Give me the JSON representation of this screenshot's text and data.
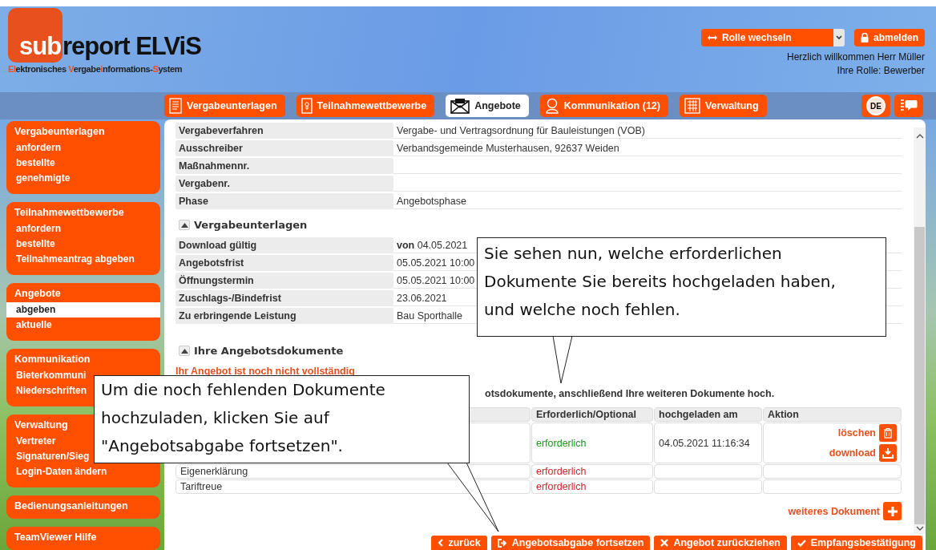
{
  "logo": {
    "mark": "sub",
    "name": "report ELViS",
    "tagline": [
      {
        "text": "El",
        "accent": true
      },
      {
        "text": "ektronisches ",
        "accent": false
      },
      {
        "text": "V",
        "accent": true
      },
      {
        "text": "ergabe",
        "accent": false
      },
      {
        "text": "i",
        "accent": true
      },
      {
        "text": "nformations-",
        "accent": false
      },
      {
        "text": "S",
        "accent": true
      },
      {
        "text": "ystem",
        "accent": false
      }
    ]
  },
  "account": {
    "role_switch": "Rolle wechseln",
    "logout": "abmelden",
    "welcome": "Herzlich willkommen Herr Müller",
    "role": "Ihre Rolle: Bewerber"
  },
  "tabs": [
    {
      "label": "Vergabeunterlagen",
      "kind": "document",
      "selected": false
    },
    {
      "label": "Teilnahmewettbewerbe",
      "kind": "keyhole",
      "selected": false
    },
    {
      "label": "Angebote",
      "kind": "envelope",
      "selected": true
    },
    {
      "label": "Kommunikation (12)",
      "kind": "person",
      "selected": false
    },
    {
      "label": "Verwaltung",
      "kind": "building",
      "selected": false
    }
  ],
  "language": "DE",
  "sidebar": [
    {
      "title": "Vergabeunterlagen",
      "items": [
        {
          "label": "anfordern",
          "selected": false
        },
        {
          "label": "bestellte",
          "selected": false
        },
        {
          "label": "genehmigte",
          "selected": false
        }
      ]
    },
    {
      "title": "Teilnahmewettbewerbe",
      "items": [
        {
          "label": "anfordern",
          "selected": false
        },
        {
          "label": "bestellte",
          "selected": false
        },
        {
          "label": "Teilnahmeantrag abgeben",
          "selected": false
        }
      ]
    },
    {
      "title": "Angebote",
      "items": [
        {
          "label": "abgeben",
          "selected": true
        },
        {
          "label": "aktuelle",
          "selected": false
        }
      ]
    },
    {
      "title": "Kommunikation",
      "items": [
        {
          "label": "Bieterkommuni",
          "selected": false
        },
        {
          "label": "Niederschriften",
          "selected": false
        }
      ]
    },
    {
      "title": "Verwaltung",
      "items": [
        {
          "label": "Vertreter",
          "selected": false
        },
        {
          "label": "Signaturen/Sieg",
          "selected": false
        },
        {
          "label": "Login-Daten ändern",
          "selected": false
        }
      ]
    },
    {
      "title": "Bedienungsanleitungen"
    },
    {
      "title": "TeamViewer Hilfe"
    }
  ],
  "details": [
    {
      "label": "Vergabeverfahren",
      "value": "Vergabe- und Vertragsordnung für Bauleistungen (VOB)"
    },
    {
      "label": "Ausschreiber",
      "value": "Verbandsgemeinde Musterhausen, 92637 Weiden"
    },
    {
      "label": "Maßnahmennr."
    },
    {
      "label": "Vergabenr."
    },
    {
      "label": "Phase",
      "value": "Angebotsphase"
    }
  ],
  "tender_section": {
    "title": "Vergabeunterlagen",
    "expanded": true,
    "rows": [
      {
        "label": "Download gültig",
        "value": "**von**  04.05.2021"
      },
      {
        "label": "Angebotsfrist",
        "value": "05.05.2021 10:00"
      },
      {
        "label": "Öffnungstermin",
        "value": "05.05.2021 10:00"
      },
      {
        "label": "Zuschlags-/Bindefrist",
        "value": "23.06.2021"
      },
      {
        "label": "Zu erbringende Leistung",
        "value": "Bau Sporthalle"
      }
    ]
  },
  "documents_section": {
    "title": "Ihre Angebotsdokumente",
    "expanded": true,
    "warning": "Ihr Angebot ist noch nicht vollständig",
    "instruction": "otsdokumente, anschließend Ihre weiteren Dokumente hoch.",
    "columns": [
      "Erforderlich/Optional",
      "hochgeladen am",
      "Aktion"
    ],
    "rows": [
      {
        "requirement": "erforderlich",
        "uploaded": true,
        "uploaded_at": "04.05.2021 11:16:34",
        "actions": [
          "löschen",
          "download"
        ]
      },
      {
        "name": "Eigenerklärung",
        "requirement": "erforderlich",
        "uploaded": false
      },
      {
        "name": "Tariftreue",
        "requirement": "erforderlich",
        "uploaded": false
      }
    ],
    "add_document": "weiteres Dokument"
  },
  "buttons": [
    {
      "label": "zurück",
      "kind": "back"
    },
    {
      "label": "Angebotsabgabe fortsetzen",
      "kind": "continue"
    },
    {
      "label": "Angebot zurückziehen",
      "kind": "withdraw"
    },
    {
      "label": "Empfangsbestätigung",
      "kind": "confirm"
    }
  ],
  "callouts": [
    {
      "text": "Sie sehen nun, welche erforderlichen Dokumente Sie bereits hochgeladen haben, und welche noch fehlen."
    },
    {
      "text": "Um die noch fehlenden Dokumente hochzuladen, klicken Sie auf \"Angebotsabgabe fortsetzen\"."
    }
  ]
}
